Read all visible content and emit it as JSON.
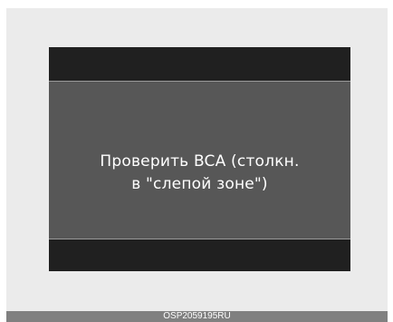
{
  "display": {
    "message_line1": "Проверить BCA (столкн.",
    "message_line2": "в \"слепой зоне\")"
  },
  "footer": {
    "code": "OSP2059195RU"
  },
  "colors": {
    "frame": "#ebebeb",
    "screen_bars": "#202020",
    "screen_body": "#575757",
    "text": "#ffffff",
    "footer_strip": "#808080"
  }
}
